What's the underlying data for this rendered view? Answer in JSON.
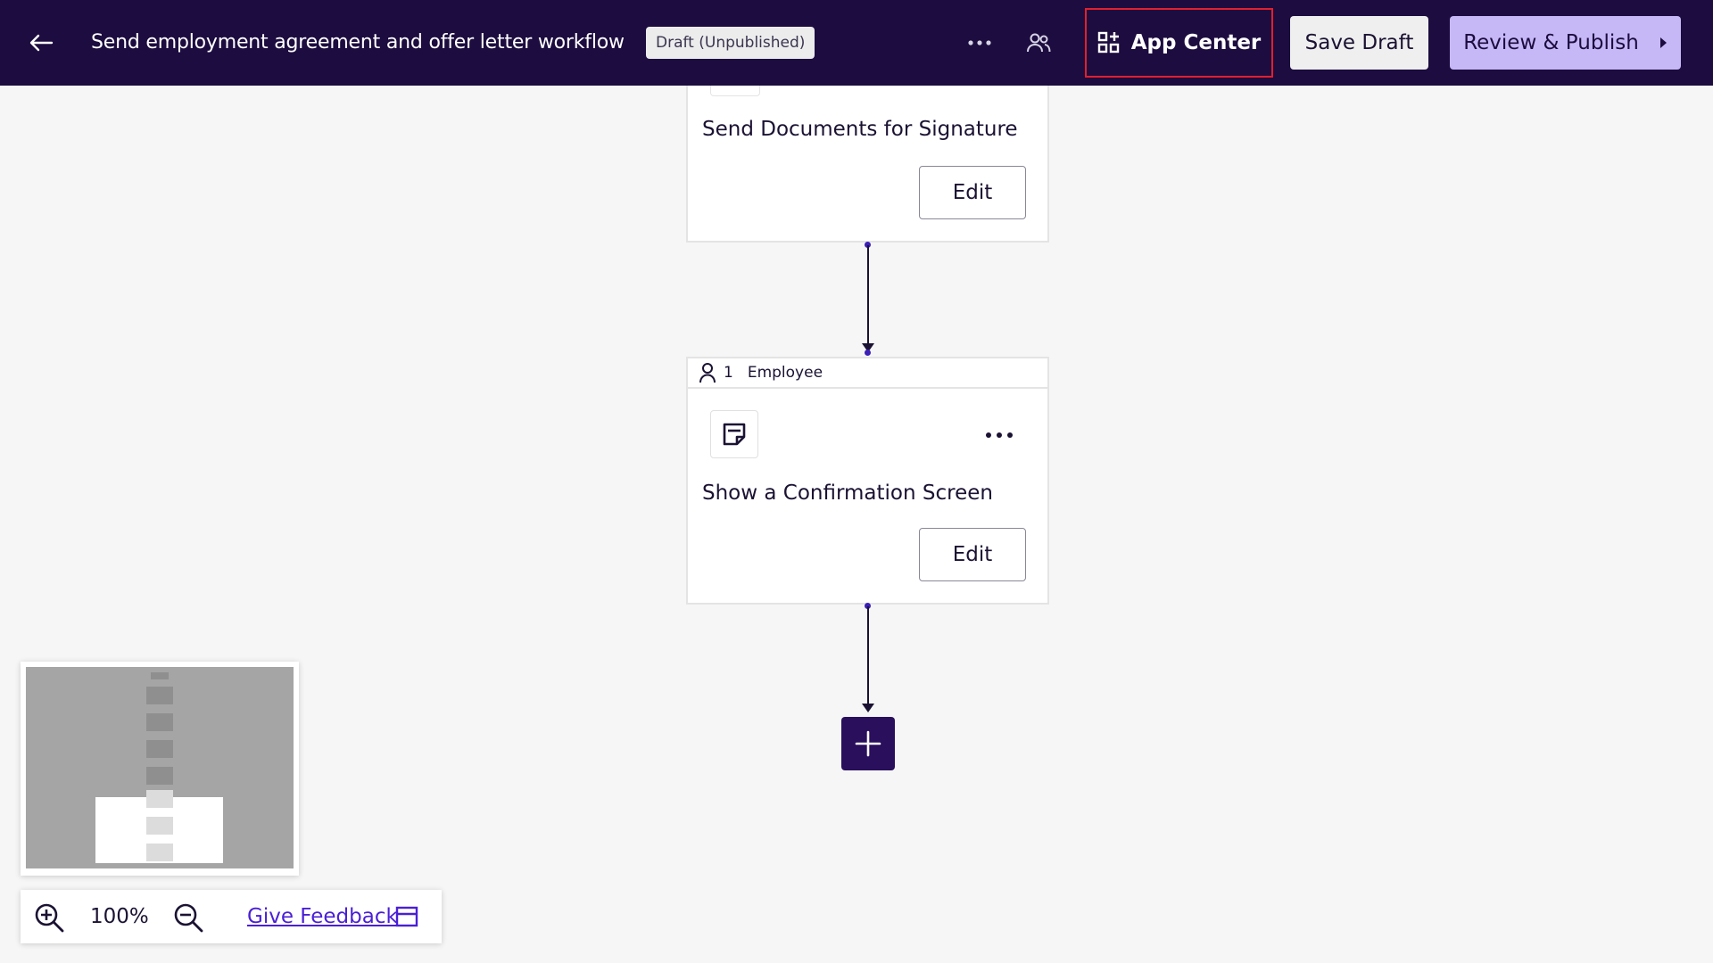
{
  "header": {
    "title": "Send employment agreement and offer letter workflow",
    "status_badge": "Draft (Unpublished)",
    "app_center_label": "App Center",
    "save_draft_label": "Save Draft",
    "review_publish_label": "Review & Publish",
    "icons": {
      "back": "arrow-left-icon",
      "more": "more-horizontal-icon",
      "collaborators": "users-icon",
      "app_center": "apps-grid-icon",
      "publish_chevron": "caret-right-icon"
    }
  },
  "steps": [
    {
      "title": "Send Documents for Signature",
      "edit_label": "Edit"
    },
    {
      "role_count": "1",
      "role_label": "Employee",
      "title": "Show a Confirmation Screen",
      "edit_label": "Edit",
      "icon": "note-icon"
    }
  ],
  "zoom": {
    "level": "100%",
    "feedback_label": "Give Feedback"
  },
  "colors": {
    "header_bg": "#1c0c3f",
    "accent": "#c6b8f6",
    "add_button": "#2a0f5c",
    "highlight_border": "#e0202e",
    "link": "#4a1fd6"
  }
}
